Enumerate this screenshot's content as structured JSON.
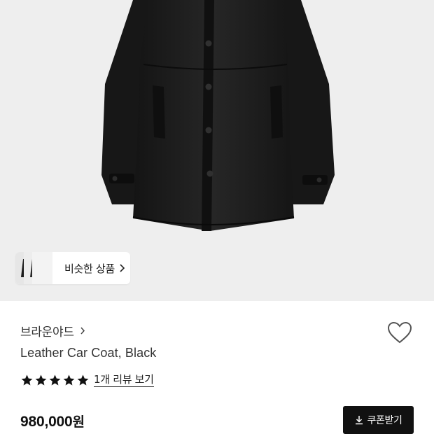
{
  "hero": {
    "image_alt_icon": "leather-coat-image"
  },
  "similar": {
    "label": "비슷한 상품",
    "chevron_icon": "chevron-right-icon"
  },
  "product": {
    "brand": "브라운야드",
    "brand_chevron_icon": "chevron-right-icon",
    "name": "Leather Car Coat, Black",
    "wishlist_icon": "heart-outline-icon",
    "rating_stars": 5,
    "review_link": "1개 리뷰 보기",
    "price_number": "980,000",
    "price_unit": "원"
  },
  "coupon": {
    "label": "쿠폰받기",
    "icon": "download-icon"
  },
  "colors": {
    "hero_bg": "#eeeeee",
    "coat": "#1b1b1b",
    "button_bg": "#111111",
    "text": "#222222"
  }
}
